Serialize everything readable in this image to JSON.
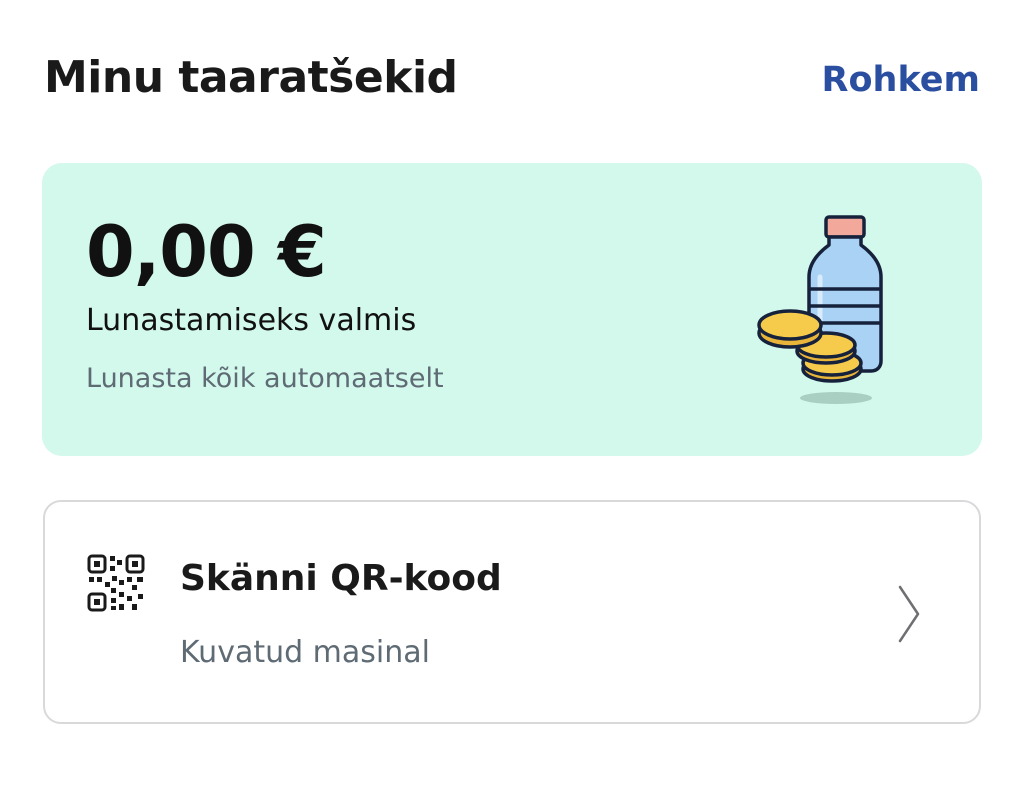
{
  "header": {
    "title": "Minu taaratšekid",
    "more_label": "Rohkem",
    "accent_color": "#2b4fa0"
  },
  "balance_card": {
    "amount": "0,00 €",
    "status": "Lunastamiseks valmis",
    "hint": "Lunasta kõik automaatselt",
    "background_color": "#d3f8ec",
    "illustration": "bottle-and-coins-icon"
  },
  "scan_card": {
    "title": "Skänni QR-kood",
    "subtitle": "Kuvatud masinal",
    "icon": "qr-code-icon",
    "chevron": "chevron-right-icon"
  }
}
